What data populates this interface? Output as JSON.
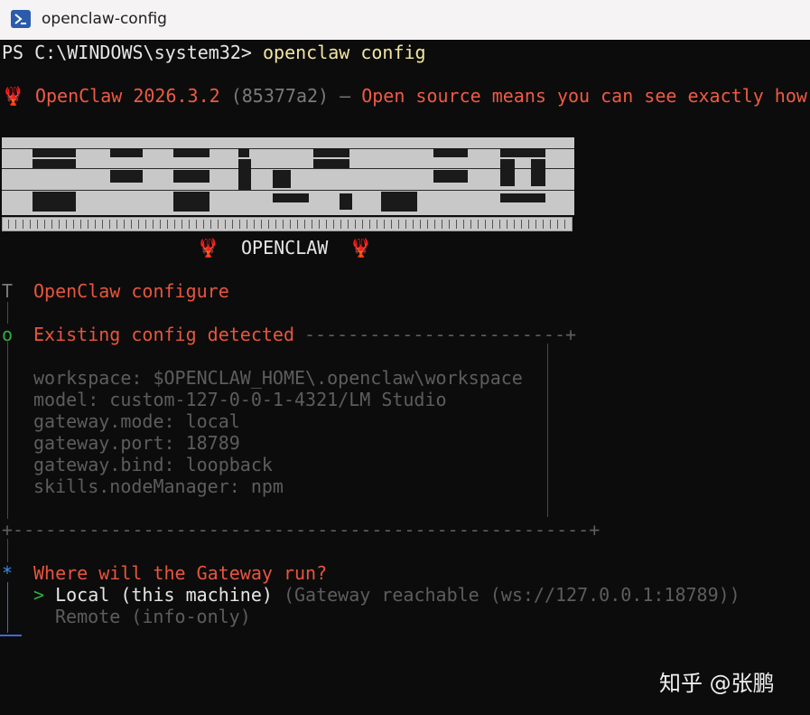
{
  "window": {
    "title": "openclaw-config"
  },
  "prompt": {
    "ps": "PS C:\\WINDOWS\\system32> ",
    "command": "openclaw config"
  },
  "version_line": {
    "icon": "🦞",
    "name": "OpenClaw 2026.3.2",
    "hash": "(85377a2)",
    "dash": "—",
    "tagline": "Open source means you can see exactly how"
  },
  "banner_logo": {
    "label": "OPENCLAW",
    "icon": "🦞"
  },
  "configure": {
    "marker": "T",
    "title": "OpenClaw configure"
  },
  "existing": {
    "marker": "o",
    "title": "Existing config detected",
    "rule": "------------------------+",
    "bottom_rule": "+-----------------------------------------------------+",
    "items": [
      "workspace: $OPENCLAW_HOME\\.openclaw\\workspace",
      "model: custom-127-0-0-1-4321/LM Studio",
      "gateway.mode: local",
      "gateway.port: 18789",
      "gateway.bind: loopback",
      "skills.nodeManager: npm"
    ]
  },
  "question": {
    "marker": "*",
    "text": "Where will the Gateway run?",
    "options": [
      {
        "pointer": ">",
        "label": "Local (this machine)",
        "hint": "(Gateway reachable (ws://127.0.0.1:18789))"
      },
      {
        "pointer": "",
        "label": "Remote (info-only)",
        "hint": ""
      }
    ]
  },
  "watermark": "知乎 @张鹏",
  "colors": {
    "accent": "#f05a44",
    "terminal_bg": "#0c0c0c",
    "selected_marker": "#3b8eea",
    "ok_marker": "#2fae41"
  }
}
